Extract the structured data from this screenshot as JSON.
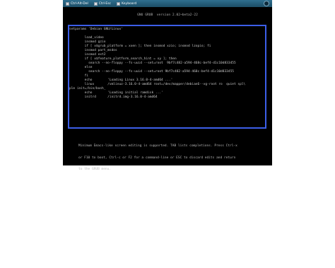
{
  "toolbar": {
    "buttons": [
      {
        "label": "Ctrl-Alt-Del",
        "icon": "keyboard-combo-icon"
      },
      {
        "label": "Ctrl-Esc",
        "icon": "keyboard-combo-icon"
      },
      {
        "label": "Keyboard",
        "icon": "keyboard-icon"
      }
    ]
  },
  "grub": {
    "title": "GNU GRUB  version 2.02~beta2-22",
    "entry_lines": [
      "setparams 'Debian GNU/Linux'",
      "",
      "        load_video",
      "        insmod gzio",
      "        if [ x$grub_platform = xxen ]; then insmod xzio; insmod lzopio; fi",
      "        insmod part_msdos",
      "        insmod ext2",
      "        if [ x$feature_platform_search_hint = xy ]; then",
      "          search --no-floppy --fs-uuid --set=root  9bf7c482-a594-468c-bef4-d1c10d833455",
      "        else",
      "          search --no-floppy --fs-uuid --set=root 9bf7c482-a594-468c-bef4-d1c10d833455",
      "        fi",
      "        echo        'Loading Linux 3.16.0-4-amd64 ...'",
      "        linux       /vmlinuz-3.16.0-4-amd64 root=/dev/mapper/debian6--vg-root ro  quiet spl\\",
      "ple init=/bin/bash_",
      "        echo        'Loading initial ramdisk ...'",
      "        initrd      /initrd.img-3.16.0-4-amd64"
    ],
    "help_lines": [
      "Minimum Emacs-like screen editing is supported. TAB lists completions. Press Ctrl-x",
      "or F10 to boot, Ctrl-c or F2 for a command-line or ESC to discard edits and return",
      "to the GRUB menu."
    ]
  },
  "colors": {
    "screen_bg": "#000000",
    "text": "#c8c8c8",
    "border": "#3c5ee8",
    "toolbar": "#1c4d66"
  }
}
